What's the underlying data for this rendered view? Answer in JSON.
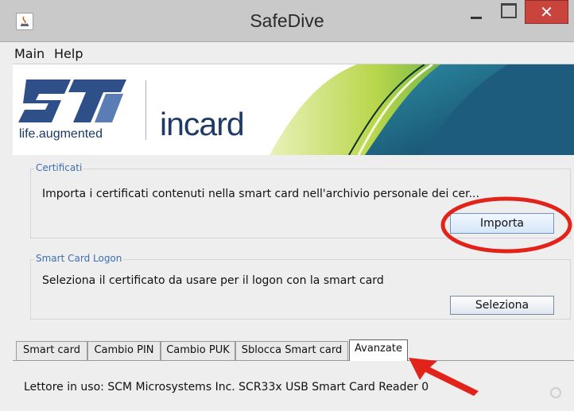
{
  "window": {
    "title": "SafeDive",
    "close_glyph": "✕"
  },
  "menu": [
    "Main",
    "Help"
  ],
  "banner": {
    "tagline": "life.augmented",
    "product": "incard"
  },
  "certificati": {
    "title": "Certificati",
    "description": "Importa i certificati contenuti nella smart card nell'archivio personale dei cer...",
    "button_label": "Importa"
  },
  "logon": {
    "title": "Smart Card Logon",
    "description": "Seleziona il certificato da usare per il logon con la smart card",
    "button_label": "Seleziona"
  },
  "tabs": [
    {
      "label": "Smart card"
    },
    {
      "label": "Cambio PIN"
    },
    {
      "label": "Cambio PUK"
    },
    {
      "label": "Sblocca Smart card"
    },
    {
      "label": "Avanzate"
    }
  ],
  "selected_tab": "Avanzate",
  "status": "Lettore in uso: SCM Microsystems Inc. SCR33x USB Smart Card Reader 0",
  "colors": {
    "accent_blue": "#3d6fb1",
    "annotation_red": "#e2231a",
    "close_button": "#c9443d",
    "brand_navy": "#1f3a66"
  }
}
